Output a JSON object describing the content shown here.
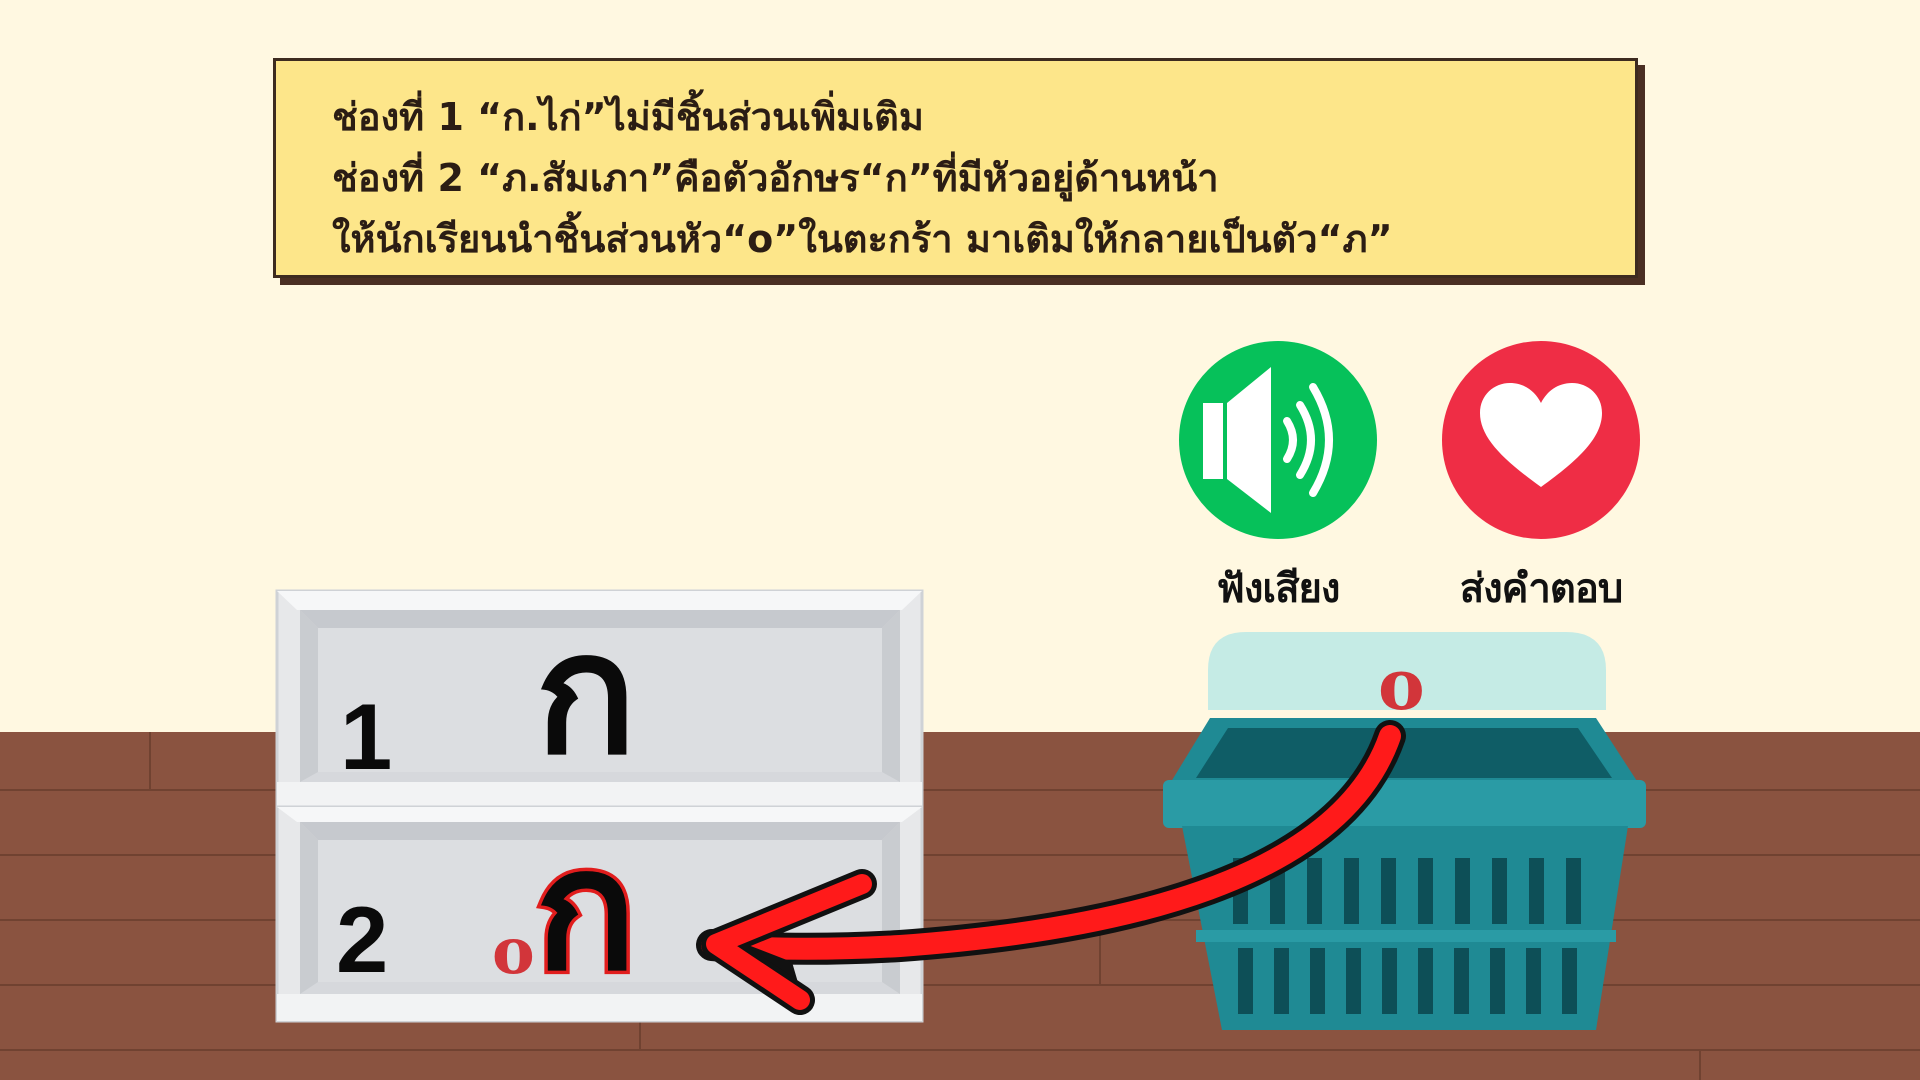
{
  "instruction": {
    "line1": "ช่องที่ 1 “ก.ไก่”ไม่มีชิ้นส่วนเพิ่มเติม",
    "line2": "ช่องที่ 2 “ภ.สัมเภา”คือตัวอักษร“ก”ที่มีหัวอยู่ด้านหน้า",
    "line3": "ให้นักเรียนนำชิ้นส่วนหัว“o”ในตะกร้า มาเติมให้กลายเป็นตัว“ภ”"
  },
  "buttons": {
    "listen": {
      "label": "ฟังเสียง",
      "icon": "speaker-icon",
      "color": "#06c15a"
    },
    "submit": {
      "label": "ส่งคำตอบ",
      "icon": "heart-icon",
      "color": "#ef2d45"
    }
  },
  "shelf": {
    "slots": [
      {
        "number": "1",
        "letter": "ก"
      },
      {
        "number": "2",
        "letter": "ก",
        "piece": "o"
      }
    ]
  },
  "basket": {
    "piece": "o",
    "icon": "basket-icon",
    "color": "#1f8a94"
  },
  "arrow": {
    "color": "#ff1a1a",
    "icon": "curved-arrow-icon"
  },
  "colors": {
    "background": "#fff8e1",
    "floor": "#8a5340",
    "card": "#fde68a",
    "piece": "#d2353a"
  }
}
